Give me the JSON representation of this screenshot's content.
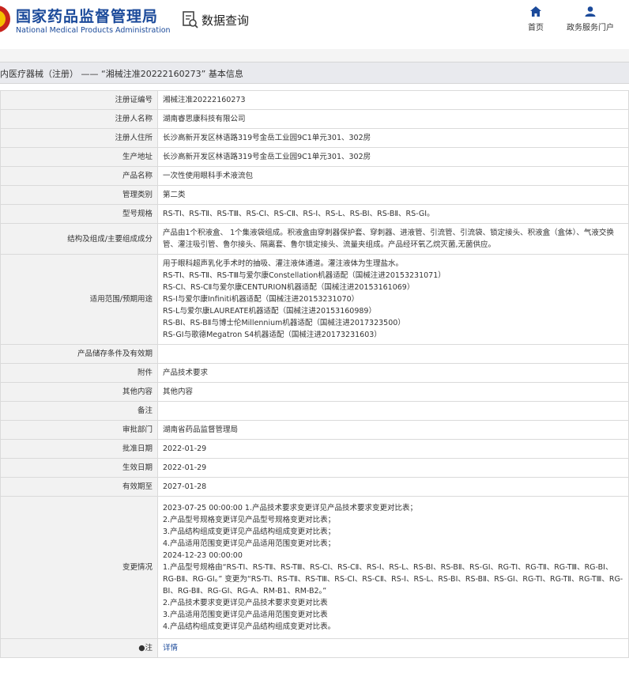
{
  "header": {
    "brand_cn": "国家药品监督管理局",
    "brand_en": "National Medical Products Administration",
    "query_label": "数据查询",
    "nav_home": "首页",
    "nav_portal": "政务服务门户"
  },
  "titlebar": "内医疗器械（注册） —— “湘械注准20222160273” 基本信息",
  "rows": [
    {
      "key": "注册证编号",
      "value": "湘械注准20222160273"
    },
    {
      "key": "注册人名称",
      "value": "湖南睿思康科技有限公司"
    },
    {
      "key": "注册人住所",
      "value": "长沙高新开发区林语路319号金岳工业园9C1单元301、302房"
    },
    {
      "key": "生产地址",
      "value": "长沙高新开发区林语路319号金岳工业园9C1单元301、302房"
    },
    {
      "key": "产品名称",
      "value": "一次性使用眼科手术液流包"
    },
    {
      "key": "管理类别",
      "value": "第二类"
    },
    {
      "key": "型号规格",
      "value": "RS-TⅠ、RS-TⅡ、RS-TⅢ、RS-CⅠ、RS-CⅡ、RS-Ⅰ、RS-L、RS-BⅠ、RS-BⅡ、RS-GⅠ。"
    },
    {
      "key": "结构及组成/主要组成成分",
      "value": "产品由1个积液盒、 1个集液袋组成。积液盒由穿刺器保护套、穿刺器、进液管、引流管、引流袋、锁定接头、积液盒（盒体）、气液交换管、灌注吸引管、鲁尔接头、隔离套、鲁尔锁定接头、流量夹组成。产品经环氧乙烷灭菌,无菌供应。"
    },
    {
      "key": "适用范围/预期用途",
      "lines": [
        "用于眼科超声乳化手术时的抽吸、灌注液体通道。灌注液体为生理盐水。",
        "RS-TⅠ、RS-TⅡ、RS-TⅢ与爱尔康Constellation机器适配（国械注进20153231071）",
        "RS-CⅠ、RS-CⅡ与爱尔康CENTURION机器适配（国械注进20153161069）",
        "RS-Ⅰ与爱尔康Infiniti机器适配（国械注进20153231070）",
        "RS-L与爱尔康LAUREATE机器适配（国械注进20153160989）",
        "RS-BⅠ、RS-BⅡ与博士伦Millennium机器适配（国械注进2017323500）",
        "RS-GⅠ与歌德Megatron S4机器适配（国械注进20173231603）"
      ]
    },
    {
      "key": "产品储存条件及有效期",
      "value": ""
    },
    {
      "key": "附件",
      "value": "产品技术要求"
    },
    {
      "key": "其他内容",
      "value": "其他内容"
    },
    {
      "key": "备注",
      "value": ""
    },
    {
      "key": "审批部门",
      "value": "湖南省药品监督管理局"
    },
    {
      "key": "批准日期",
      "value": "2022-01-29"
    },
    {
      "key": "生效日期",
      "value": "2022-01-29"
    },
    {
      "key": "有效期至",
      "value": "2027-01-28"
    },
    {
      "key": "变更情况",
      "lines": [
        "2023-07-25 00:00:00 1.产品技术要求变更详见产品技术要求变更对比表；",
        "2.产品型号规格变更详见产品型号规格变更对比表；",
        "3.产品结构组成变更详见产品结构组成变更对比表；",
        "4.产品适用范围变更详见产品适用范围变更对比表；",
        "2024-12-23 00:00:00",
        "1.产品型号规格由“RS-TⅠ、RS-TⅡ、RS-TⅢ、RS-CⅠ、RS-CⅡ、RS-Ⅰ、RS-L、RS-BⅠ、RS-BⅡ、RS-GⅠ、RG-TⅠ、RG-TⅡ、RG-TⅢ、RG-BⅠ、RG-BⅡ、RG-GⅠ。” 变更为“RS-TⅠ、RS-TⅡ、RS-TⅢ、RS-CⅠ、RS-CⅡ、RS-Ⅰ、RS-L、RS-BⅠ、RS-BⅡ、RS-GⅠ、RG-TⅠ、RG-TⅡ、RG-TⅢ、RG-BⅠ、RG-BⅡ、RG-GⅠ、RG-A、RM-B1、RM-B2。”",
        "2.产品技术要求变更详见产品技术要求变更对比表",
        "3.产品适用范围变更详见产品适用范围变更对比表",
        "4.产品结构组成变更详见产品结构组成变更对比表。"
      ]
    },
    {
      "key": "●注",
      "link": "详情"
    }
  ]
}
